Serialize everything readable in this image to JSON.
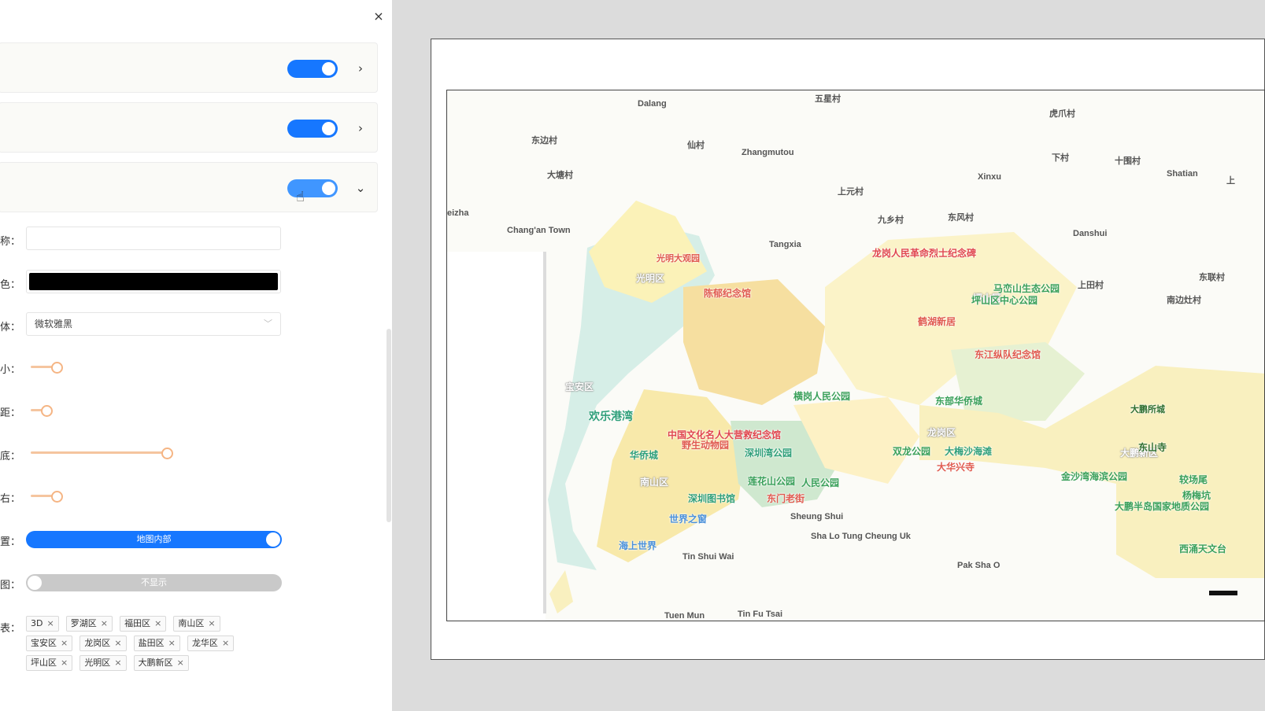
{
  "panel": {
    "close_glyph": "×",
    "sections": [
      {
        "toggle_on": true,
        "chevron": "›"
      },
      {
        "toggle_on": true,
        "chevron": "›"
      },
      {
        "toggle_on": true,
        "chevron": "⌄"
      }
    ],
    "field_labels": [
      "称：",
      "色：",
      "体：",
      "小：",
      "距：",
      "底：",
      "右：",
      "置：",
      "图：",
      "表："
    ],
    "font_select": {
      "value": "微软雅黑"
    },
    "text_color": "#000000",
    "sliders": {
      "size": 0.19,
      "spacing": 0.11,
      "bottom": 1.0,
      "right": 0.19
    },
    "position_switch": {
      "label": "地图内部",
      "on": true
    },
    "legend_switch": {
      "label": "不显示",
      "on": false
    },
    "tags": [
      "3D",
      "罗湖区",
      "福田区",
      "南山区",
      "宝安区",
      "龙岗区",
      "盐田区",
      "龙华区",
      "坪山区",
      "光明区",
      "大鹏新区"
    ],
    "tag_close": "×"
  },
  "map": {
    "places": [
      "Dalang",
      "五星村",
      "虎爪村",
      "东边村",
      "仙村",
      "Zhangmutou",
      "下村",
      "十围村",
      "Shatian",
      "大塘村",
      "Xinxu",
      "上元村",
      "eizha",
      "九乡村",
      "东风村",
      "Chang'an Town",
      "Tangxia",
      "Danshui",
      "上田村",
      "东联村",
      "南边灶村",
      "Sheung Shui",
      "Sha Lo Tung Cheung Uk",
      "Tin Shui Wai",
      "Pak Sha O",
      "Tuen Mun",
      "Tin Fu Tsai",
      "上"
    ],
    "districts": [
      "光明区",
      "宝安区",
      "南山区",
      "大鹏新区",
      "坪山区",
      "龙岗区"
    ],
    "pois": [
      "东江纵队纪念馆",
      "龙岗人民革命烈士纪念碑",
      "鹤湖新居",
      "马峦山生态公园",
      "坪山区中心公园",
      "欢乐港湾",
      "深圳湾公园",
      "深圳图书馆",
      "世界之窗",
      "海上世界",
      "华侨城",
      "双龙公园",
      "大华兴寺",
      "大梅沙海滩",
      "东部华侨城",
      "大鹏所城",
      "东山寺",
      "较场尾",
      "杨梅坑",
      "大鹏半岛国家地质公园",
      "西涌天文台",
      "金沙湾海滨公园",
      "横岗人民公园",
      "野生动物园",
      "中国文化名人大营救纪念馆",
      "莲花山公园",
      "人民公园",
      "东门老街",
      "光明大观园",
      "陈郁纪念馆"
    ]
  }
}
